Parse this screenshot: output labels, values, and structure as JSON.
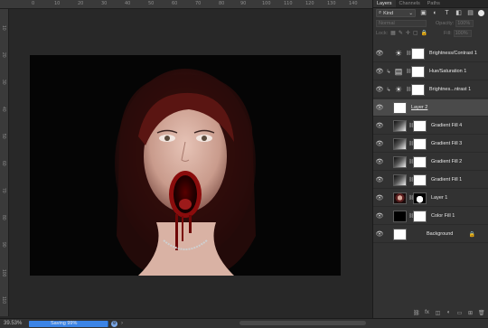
{
  "rulers": {
    "top": [
      "0",
      "10",
      "20",
      "30",
      "40",
      "50",
      "60",
      "70",
      "80",
      "90",
      "100",
      "110",
      "120",
      "130",
      "140"
    ],
    "left": [
      "10",
      "20",
      "30",
      "40",
      "50",
      "60",
      "70",
      "80",
      "90",
      "100",
      "110"
    ]
  },
  "status": {
    "zoom": "39.53%",
    "saving_text": "Saving 99%",
    "saving_progress": 0.99
  },
  "panel": {
    "tabs": [
      "Layers",
      "Channels",
      "Paths"
    ],
    "kind_label": "Kind",
    "blend_mode": "Normal",
    "opacity_label": "Opacity:",
    "opacity_value": "100%",
    "lock_label": "Lock:",
    "fill_label": "Fill:",
    "fill_value": "100%"
  },
  "layers": [
    {
      "name": "Brightness/Contrast 1",
      "icon": "brightness-icon",
      "thumb": "white",
      "mask": "none",
      "clip": false,
      "selected": false
    },
    {
      "name": "Hue/Saturation 1",
      "icon": "hue-saturation-icon",
      "thumb": "white",
      "mask": "none",
      "clip": true,
      "selected": false
    },
    {
      "name": "Brightnes...ntrast 1",
      "icon": "brightness-icon",
      "thumb": "white",
      "mask": "none",
      "clip": true,
      "selected": false
    },
    {
      "name": "Layer 2",
      "icon": "",
      "thumb": "white-dot",
      "mask": "none",
      "clip": false,
      "selected": true
    },
    {
      "name": "Gradient Fill 4",
      "icon": "",
      "thumb": "grad",
      "mask": "white",
      "clip": false,
      "selected": false
    },
    {
      "name": "Gradient Fill 3",
      "icon": "",
      "thumb": "grad",
      "mask": "white",
      "clip": false,
      "selected": false
    },
    {
      "name": "Gradient Fill 2",
      "icon": "",
      "thumb": "grad",
      "mask": "white",
      "clip": false,
      "selected": false
    },
    {
      "name": "Gradient Fill 1",
      "icon": "",
      "thumb": "grad",
      "mask": "white",
      "clip": false,
      "selected": false
    },
    {
      "name": "Layer 1",
      "icon": "",
      "thumb": "face",
      "mask": "silhouette",
      "clip": false,
      "selected": false
    },
    {
      "name": "Color Fill 1",
      "icon": "",
      "thumb": "black",
      "mask": "white",
      "clip": false,
      "selected": false
    },
    {
      "name": "Background",
      "icon": "",
      "thumb": "white",
      "mask": "none",
      "clip": false,
      "selected": false,
      "locked": true
    }
  ]
}
